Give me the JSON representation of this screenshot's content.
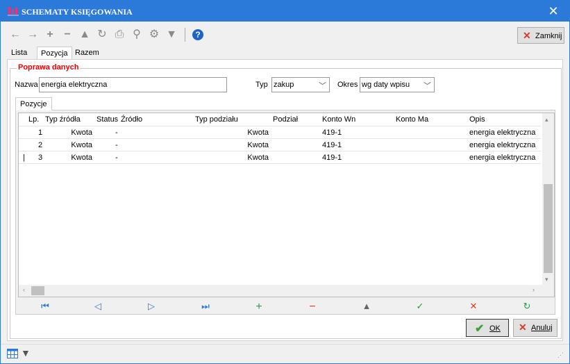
{
  "window": {
    "title": "SCHEMATY KSIĘGOWANIA"
  },
  "toolbar": {
    "items": [
      "back-arrow-icon",
      "forward-arrow-icon",
      "add-icon",
      "remove-icon",
      "edit-icon",
      "refresh-icon",
      "print-icon",
      "search-icon",
      "settings-icon",
      "filter-icon",
      "help-icon"
    ],
    "close_label": "Zamknij"
  },
  "tabs": [
    "Lista",
    "Pozycja",
    "Razem"
  ],
  "form": {
    "section_title": "Poprawa danych",
    "name_label": "Nazwa",
    "name_value": "energia elektryczna",
    "type_label": "Typ",
    "type_value": "zakup",
    "period_label": "Okres",
    "period_value": "wg daty wpisu"
  },
  "subtab": "Pozycje",
  "grid": {
    "columns": [
      "Lp.",
      "Typ źródła",
      "Status",
      "Źródło",
      "Typ podziału",
      "Podział",
      "Konto Wn",
      "Konto Ma",
      "Opis"
    ],
    "rows": [
      [
        "1",
        "Kwota",
        "-",
        "",
        "Kwota",
        "",
        "419-1",
        "",
        "energia elektryczna"
      ],
      [
        "2",
        "Kwota",
        "-",
        "",
        "Kwota",
        "",
        "419-1",
        "",
        "energia elektryczna"
      ],
      [
        "3",
        "Kwota",
        "-",
        "",
        "Kwota",
        "",
        "419-1",
        "",
        "energia elektryczna"
      ]
    ],
    "current_row_marker": "|"
  },
  "navigator": [
    "first-icon",
    "prior-icon",
    "next-icon",
    "last-icon",
    "insert-icon",
    "delete-icon",
    "edit-icon",
    "post-icon",
    "cancel-icon",
    "refresh-icon"
  ],
  "buttons": {
    "ok": "OK",
    "cancel": "Anuluj"
  },
  "colors": {
    "titlebar": "#2b79d8",
    "legend": "#e00000",
    "ok_check": "#3aa03a",
    "cancel_x": "#d83a2b"
  }
}
